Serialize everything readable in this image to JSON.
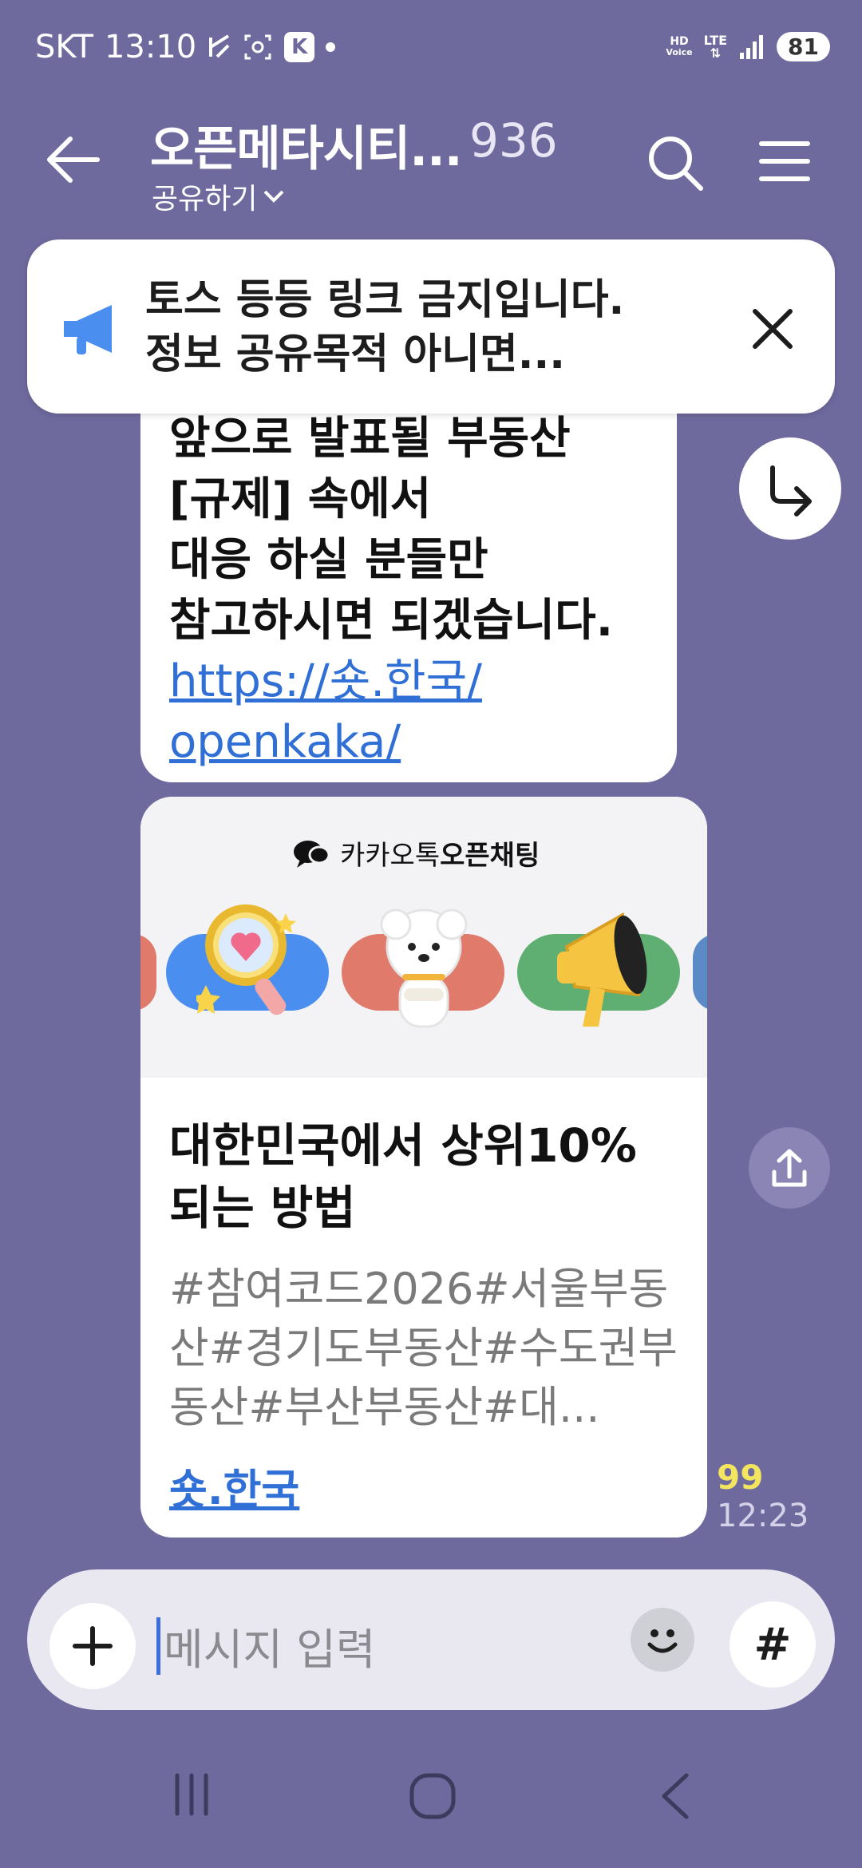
{
  "status_bar": {
    "carrier": "SKT",
    "time": "13:10",
    "k_badge": "K",
    "hd_top": "HD",
    "hd_bottom": "Voice",
    "lte": "LTE",
    "battery": "81"
  },
  "header": {
    "title": "오픈메타시티...",
    "member_count": "936",
    "share_label": "공유하기"
  },
  "notice": {
    "line1": "토스 등등 링크 금지입니다.",
    "line2": "정보 공유목적 아니면..."
  },
  "message1": {
    "line_cut": "앞으로 발표될 부동산",
    "line2": "[규제] 속에서",
    "line3": "대응 하실 분들만",
    "line4": "참고하시면 되겠습니다.",
    "link_line1": "https://숏.한국/",
    "link_line2": "openkaka/"
  },
  "card": {
    "brand_prefix": "카카오톡",
    "brand_bold": "오픈채팅",
    "title": "대한민국에서 상위10% 되는 방법",
    "tags": "#참여코드2026#서울부동산#경기도부동산#수도권부동산#부산부동산#대...",
    "link": "숏.한국"
  },
  "meta": {
    "unread": "99",
    "time": "12:23"
  },
  "input": {
    "placeholder": "메시지 입력",
    "hash": "#"
  },
  "colors": {
    "background": "#6f6a9e",
    "link": "#2f6fd6",
    "unread": "#f3e55f"
  }
}
